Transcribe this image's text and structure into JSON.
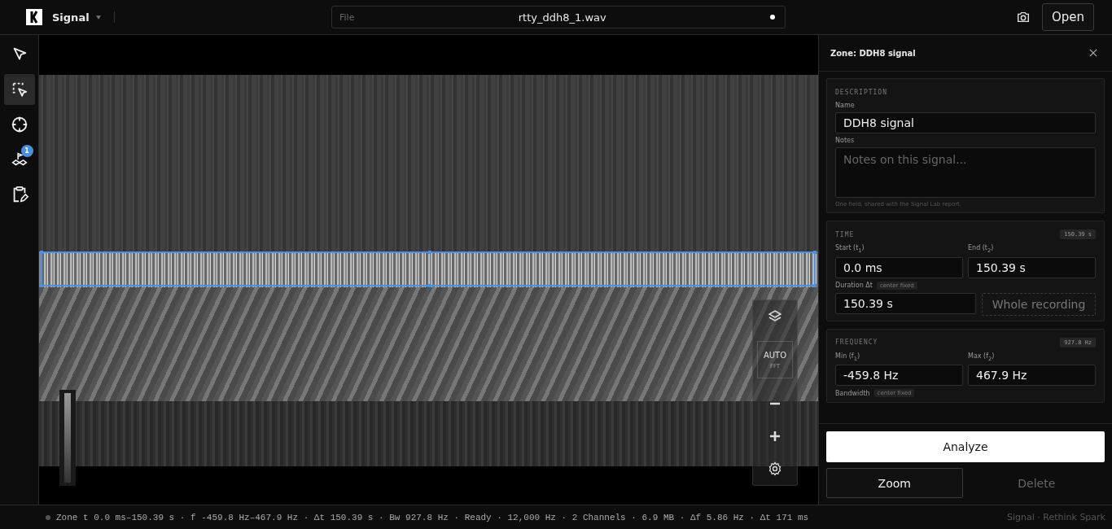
{
  "app": {
    "name": "Signal"
  },
  "file": {
    "label": "File",
    "name": "rtty_ddh8_1.wav",
    "unsaved": true
  },
  "open_button": "Open",
  "tools": [
    {
      "kind": "pointer",
      "selected": false
    },
    {
      "kind": "box-select",
      "selected": true
    },
    {
      "kind": "crosshair",
      "selected": false
    },
    {
      "kind": "markers",
      "selected": false,
      "badge": "1"
    },
    {
      "kind": "report",
      "selected": false
    }
  ],
  "view_controls": {
    "mode": "AUTO",
    "sub": "FFT"
  },
  "panel": {
    "title": "Zone: DDH8 signal",
    "description": {
      "heading": "DESCRIPTION",
      "name_label": "Name",
      "name_value": "DDH8 signal",
      "notes_label": "Notes",
      "notes_placeholder": "Notes on this signal...",
      "hint": "One field, shared with the Signal Lab report."
    },
    "time": {
      "heading": "TIME",
      "total": "150.39 s",
      "start_label": "Start (t$_{1}$)",
      "start_value": "0.0 ms",
      "end_label": "End (t$_{2}$)",
      "end_value": "150.39 s",
      "duration_label": "Duration Δt",
      "duration_tag": "center fixed",
      "duration_value": "150.39 s",
      "whole_button": "Whole recording"
    },
    "frequency": {
      "heading": "FREQUENCY",
      "total": "927.8 Hz",
      "min_label": "Min (f$_{1}$)",
      "min_value": "-459.8 Hz",
      "max_label": "Max (f$_{2}$)",
      "max_value": "467.9 Hz",
      "bandwidth_label": "Bandwidth",
      "bandwidth_tag": "center fixed"
    }
  },
  "actions": [
    {
      "kind": "primary",
      "label": "Analyze",
      "disabled": false
    },
    {
      "kind": "outline",
      "label": "Zoom",
      "disabled": false
    },
    {
      "kind": "plain",
      "label": "Delete",
      "disabled": true
    }
  ],
  "status_bar": {
    "text": "Zone t 0.0 ms–150.39 s · f -459.8 Hz–467.9 Hz · Δt 150.39 s · Bw 927.8 Hz · Ready · 12,000 Hz · 2 Channels · 6.9 MB · Δf 5.86 Hz · Δt 171 ms",
    "credit": "Signal · Rethink Spark"
  }
}
